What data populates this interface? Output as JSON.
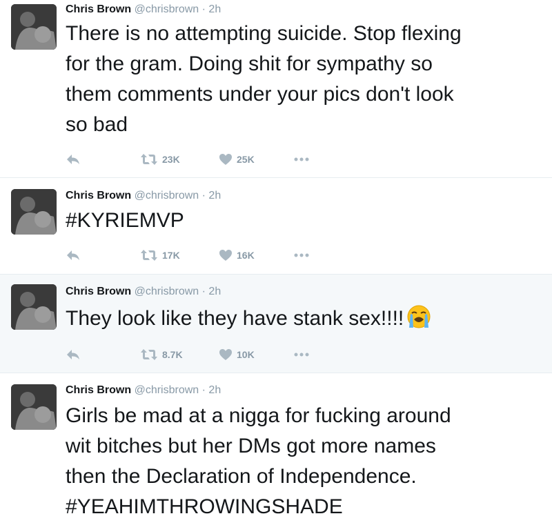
{
  "tweets": [
    {
      "name": "Chris Brown",
      "handle": "@chrisbrown",
      "sep": "·",
      "time": "2h",
      "text": "There is no attempting suicide. Stop flexing\nfor the gram. Doing shit for sympathy so\nthem comments under your pics don't look\nso bad",
      "retweets": "23K",
      "likes": "25K"
    },
    {
      "name": "Chris Brown",
      "handle": "@chrisbrown",
      "sep": "·",
      "time": "2h",
      "text": "#KYRIEMVP",
      "retweets": "17K",
      "likes": "16K"
    },
    {
      "name": "Chris Brown",
      "handle": "@chrisbrown",
      "sep": "·",
      "time": "2h",
      "text": "They look like they have stank sex!!!!",
      "emoji": "loudly-crying-face",
      "retweets": "8.7K",
      "likes": "10K"
    },
    {
      "name": "Chris Brown",
      "handle": "@chrisbrown",
      "sep": "·",
      "time": "2h",
      "text": "Girls be mad at a nigga for fucking around\nwit bitches but her DMs got more names\nthen the Declaration of Independence.\n#YEAHIMTHROWINGSHADE"
    }
  ],
  "icons": {
    "reply": "reply-icon",
    "retweet": "retweet-icon",
    "like": "heart-icon",
    "more": "more-icon"
  },
  "colors": {
    "icon": "#aab8c2",
    "meta": "#8899a6",
    "highlight_bg": "#f5f8fa",
    "divider": "#e6ecf0"
  }
}
